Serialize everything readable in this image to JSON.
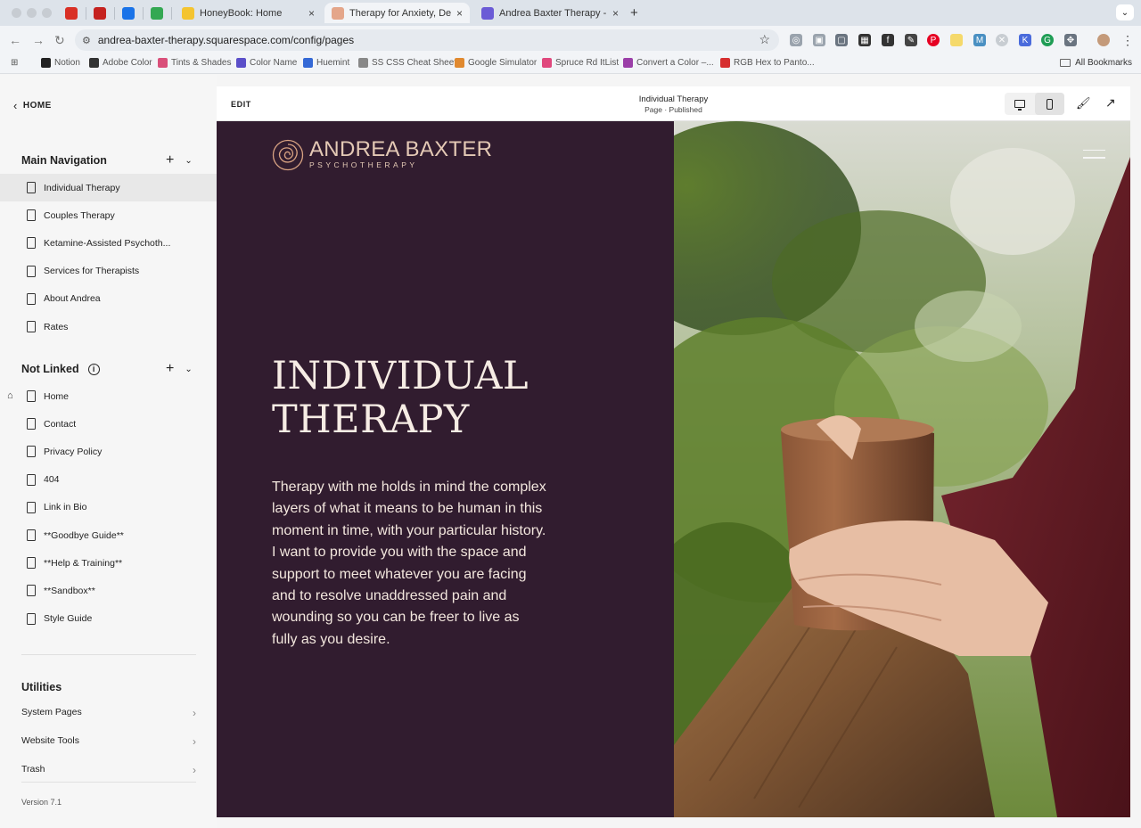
{
  "browser": {
    "tabs": [
      {
        "label": "",
        "icon": "gmail-icon",
        "color": "#d93025",
        "pinned": true
      },
      {
        "label": "",
        "icon": "gmail-icon",
        "color": "#c5221f",
        "pinned": true
      },
      {
        "label": "",
        "icon": "calendar-icon",
        "color": "#1a73e8",
        "pinned": true
      },
      {
        "label": "",
        "icon": "phone-icon",
        "color": "#34a853",
        "pinned": true
      },
      {
        "label": "HoneyBook: Home",
        "icon": "honeybook-icon",
        "color": "#f4c430"
      },
      {
        "label": "Therapy for Anxiety, Depress",
        "icon": "site-icon",
        "color": "#e4a68a",
        "active": true
      },
      {
        "label": "Andrea Baxter Therapy - Edit",
        "icon": "squarespace-icon",
        "color": "#6b5bd6"
      }
    ],
    "url": "andrea-baxter-therapy.squarespace.com/config/pages",
    "bookmarks": [
      {
        "label": "Notion",
        "color": "#222222"
      },
      {
        "label": "Adobe Color",
        "color": "#333333"
      },
      {
        "label": "Tints & Shades",
        "color": "#d94f7a"
      },
      {
        "label": "Color Name",
        "color": "#5b4fc9"
      },
      {
        "label": "Huemint",
        "color": "#3569d6"
      },
      {
        "label": "SS CSS Cheat Sheet",
        "color": "#888888"
      },
      {
        "label": "Google Simulator",
        "color": "#e0892f"
      },
      {
        "label": "Spruce Rd ItList",
        "color": "#e0487d"
      },
      {
        "label": "Convert a Color –...",
        "color": "#9b3fa8"
      },
      {
        "label": "RGB Hex to Panto...",
        "color": "#d62f2f"
      }
    ],
    "all_bookmarks": "All Bookmarks"
  },
  "sidebar": {
    "home_label": "HOME",
    "main_nav_title": "Main Navigation",
    "main_nav_items": [
      {
        "label": "Individual Therapy",
        "selected": true
      },
      {
        "label": "Couples Therapy"
      },
      {
        "label": "Ketamine-Assisted Psychoth..."
      },
      {
        "label": "Services for Therapists"
      },
      {
        "label": "About Andrea"
      },
      {
        "label": "Rates"
      }
    ],
    "not_linked_title": "Not Linked",
    "not_linked_items": [
      {
        "label": "Home",
        "is_homepage": true
      },
      {
        "label": "Contact"
      },
      {
        "label": "Privacy Policy"
      },
      {
        "label": "404"
      },
      {
        "label": "Link in Bio"
      },
      {
        "label": "**Goodbye Guide**"
      },
      {
        "label": "**Help & Training**"
      },
      {
        "label": "**Sandbox**"
      },
      {
        "label": "Style Guide"
      }
    ],
    "utilities_title": "Utilities",
    "utilities": [
      {
        "label": "System Pages"
      },
      {
        "label": "Website Tools"
      },
      {
        "label": "Trash"
      }
    ],
    "version": "Version 7.1"
  },
  "editor": {
    "edit_label": "EDIT",
    "page_title": "Individual Therapy",
    "page_status": "Page · Published"
  },
  "site": {
    "logo_name": "ANDREA BAXTER",
    "logo_sub": "PSYCHOTHERAPY",
    "hero_title_line1": "INDIVIDUAL",
    "hero_title_line2": "THERAPY",
    "hero_text": "Therapy with me holds in mind the complex layers of what it means to be human in this moment in time, with your particular history. I want to provide you with the space and support to meet whatever you are facing and to resolve unaddressed pain and wounding so you can be freer to live as fully as you desire.",
    "panel_color": "#311c2f",
    "accent_color": "#e4c9b5"
  }
}
